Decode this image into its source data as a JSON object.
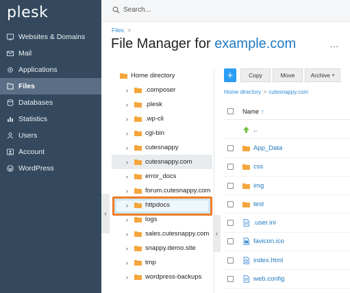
{
  "app": {
    "logo": "plesk"
  },
  "colors": {
    "sidebar": "#34495e",
    "accent": "#2a9df4",
    "folder": "#f4a63c",
    "highlight": "#f07b26"
  },
  "sidebar": {
    "items": [
      {
        "label": "Websites & Domains",
        "icon": "globe-icon"
      },
      {
        "label": "Mail",
        "icon": "mail-icon"
      },
      {
        "label": "Applications",
        "icon": "gear-icon"
      },
      {
        "label": "Files",
        "icon": "file-icon",
        "active": true
      },
      {
        "label": "Databases",
        "icon": "database-icon"
      },
      {
        "label": "Statistics",
        "icon": "stats-icon"
      },
      {
        "label": "Users",
        "icon": "user-icon"
      },
      {
        "label": "Account",
        "icon": "account-icon"
      },
      {
        "label": "WordPress",
        "icon": "wordpress-icon"
      }
    ]
  },
  "search": {
    "placeholder": "Search..."
  },
  "header": {
    "breadcrumb": "Files",
    "breadcrumb_sep": ">",
    "title_prefix": "File Manager for",
    "title_domain": "example.com",
    "more": "..."
  },
  "tree": {
    "root": "Home directory",
    "items": [
      ".composer",
      ".plesk",
      ".wp-cli",
      "cgi-bin",
      "cutesnappy",
      "cutesnappy.com",
      "error_docs",
      "forum.cutesnappy.com",
      "httpdocs",
      "logs",
      "sales.cutesnappy.com",
      "snappy.demo.site",
      "tmp",
      "wordpress-backups"
    ],
    "collapse_left": "‹",
    "collapse_mid": "‹"
  },
  "toolbar": {
    "add": "+",
    "copy": "Copy",
    "move": "Move",
    "archive": "Archive",
    "archive_caret": "▾"
  },
  "path": {
    "home": "Home directory",
    "sep": ">",
    "current": "cutesnappy.com"
  },
  "columns": {
    "name": "Name",
    "sort_arrow": "↑"
  },
  "files": [
    {
      "name": "..",
      "type": "up"
    },
    {
      "name": "App_Data",
      "type": "folder"
    },
    {
      "name": "css",
      "type": "folder"
    },
    {
      "name": "img",
      "type": "folder"
    },
    {
      "name": "test",
      "type": "folder"
    },
    {
      "name": ".user.ini",
      "type": "file"
    },
    {
      "name": "favicon.ico",
      "type": "image"
    },
    {
      "name": "index.html",
      "type": "html"
    },
    {
      "name": "web.config",
      "type": "file"
    }
  ]
}
